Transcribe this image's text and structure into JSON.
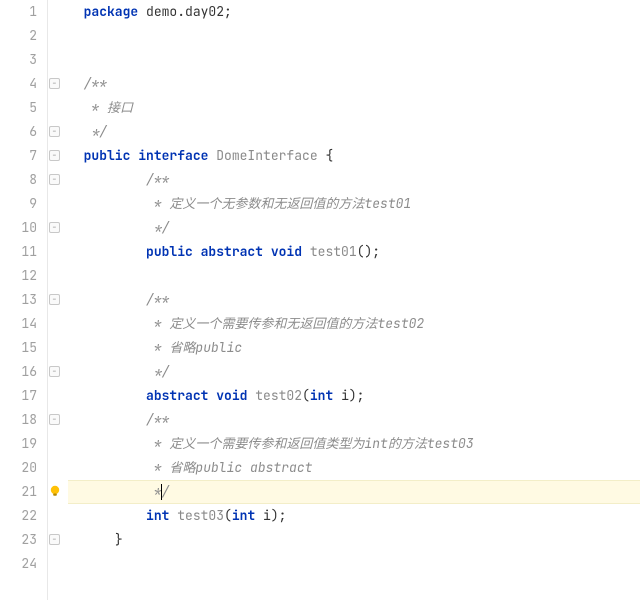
{
  "lineCount": 24,
  "currentLine": 21,
  "foldMarks": [
    4,
    6,
    7,
    8,
    10,
    13,
    16,
    18,
    23
  ],
  "bulbLine": 21,
  "lines": {
    "1": [
      {
        "t": "package ",
        "c": "kw"
      },
      {
        "t": "demo.day02",
        "c": "punc"
      },
      {
        "t": ";",
        "c": "semi"
      }
    ],
    "2": [],
    "3": [],
    "4": [
      {
        "t": "/**",
        "c": "comment"
      }
    ],
    "5": [
      {
        "t": " * 接口",
        "c": "comment"
      }
    ],
    "6": [
      {
        "t": " */",
        "c": "comment"
      }
    ],
    "7": [
      {
        "t": "public ",
        "c": "kw"
      },
      {
        "t": "interface ",
        "c": "kw"
      },
      {
        "t": "DomeInterface ",
        "c": "cls"
      },
      {
        "t": "{",
        "c": "punc"
      }
    ],
    "8": [
      {
        "t": "    /**",
        "c": "comment"
      }
    ],
    "9": [
      {
        "t": "     * 定义一个无参数和无返回值的方法test01",
        "c": "comment"
      }
    ],
    "10": [
      {
        "t": "     */",
        "c": "comment"
      }
    ],
    "11": [
      {
        "t": "    ",
        "c": "punc"
      },
      {
        "t": "public ",
        "c": "kw"
      },
      {
        "t": "abstract ",
        "c": "kw"
      },
      {
        "t": "void ",
        "c": "type"
      },
      {
        "t": "test01",
        "c": "method"
      },
      {
        "t": "();",
        "c": "punc"
      }
    ],
    "12": [],
    "13": [
      {
        "t": "    /**",
        "c": "comment"
      }
    ],
    "14": [
      {
        "t": "     * 定义一个需要传参和无返回值的方法test02",
        "c": "comment"
      }
    ],
    "15": [
      {
        "t": "     * 省略public",
        "c": "comment"
      }
    ],
    "16": [
      {
        "t": "     */",
        "c": "comment"
      }
    ],
    "17": [
      {
        "t": "    ",
        "c": "punc"
      },
      {
        "t": "abstract ",
        "c": "kw"
      },
      {
        "t": "void ",
        "c": "type"
      },
      {
        "t": "test02",
        "c": "method"
      },
      {
        "t": "(",
        "c": "punc"
      },
      {
        "t": "int ",
        "c": "type"
      },
      {
        "t": "i",
        "c": "punc"
      },
      {
        "t": ");",
        "c": "punc"
      }
    ],
    "18": [
      {
        "t": "    /**",
        "c": "comment"
      }
    ],
    "19": [
      {
        "t": "     * 定义一个需要传参和返回值类型为int的方法test03",
        "c": "comment"
      }
    ],
    "20": [
      {
        "t": "     * 省略public abstract",
        "c": "comment"
      }
    ],
    "21": [
      {
        "t": "     */",
        "c": "comment",
        "caret": true
      }
    ],
    "22": [
      {
        "t": "    ",
        "c": "punc"
      },
      {
        "t": "int ",
        "c": "type"
      },
      {
        "t": "test03",
        "c": "method"
      },
      {
        "t": "(",
        "c": "punc"
      },
      {
        "t": "int ",
        "c": "type"
      },
      {
        "t": "i",
        "c": "punc"
      },
      {
        "t": ");",
        "c": "punc"
      }
    ],
    "23": [
      {
        "t": "}",
        "c": "punc"
      }
    ],
    "24": []
  },
  "indent": {
    "1": 0,
    "2": 0,
    "3": 0,
    "4": 0,
    "5": 0,
    "6": 0,
    "7": 0,
    "8": 0,
    "9": 0,
    "10": 0,
    "11": 0,
    "12": 0,
    "13": 0,
    "14": 0,
    "15": 0,
    "16": 0,
    "17": 0,
    "18": 0,
    "19": 0,
    "20": 0,
    "21": 0,
    "22": 0,
    "23": 0,
    "24": 0
  }
}
